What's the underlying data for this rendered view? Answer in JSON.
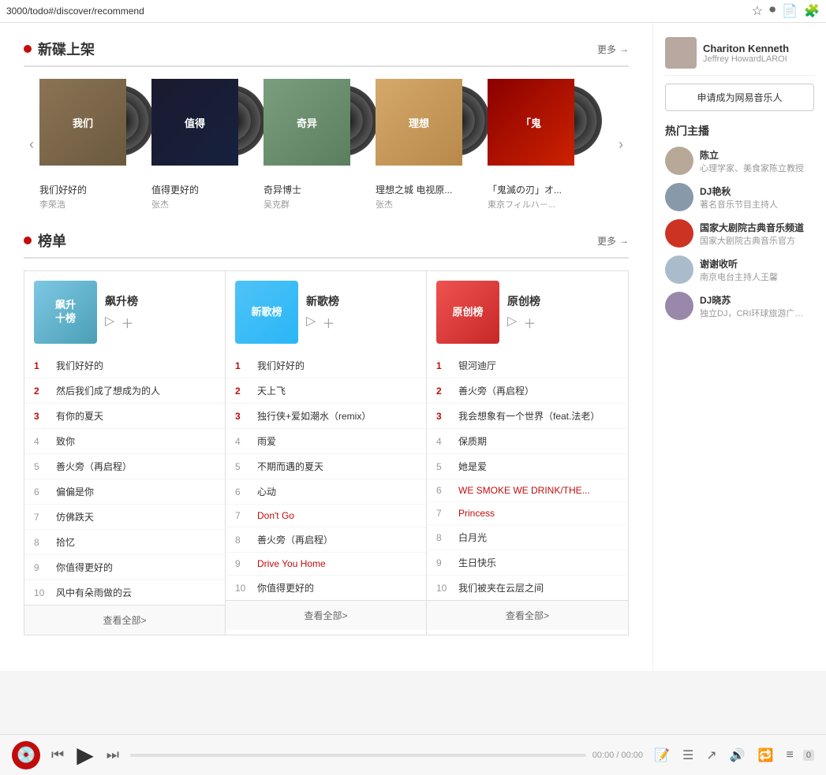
{
  "topbar": {
    "url": "3000/todo#/discover/recommend"
  },
  "newAlbums": {
    "title": "新碟上架",
    "moreLabel": "更多",
    "albums": [
      {
        "id": 1,
        "title": "我们好好的",
        "artist": "李荣浩",
        "coverClass": "cover-1"
      },
      {
        "id": 2,
        "title": "值得更好的",
        "artist": "张杰",
        "coverClass": "cover-2"
      },
      {
        "id": 3,
        "title": "奇异博士",
        "artist": "吴克群",
        "coverClass": "cover-3"
      },
      {
        "id": 4,
        "title": "理想之城 电视原...",
        "artist": "张杰",
        "coverClass": "cover-4"
      },
      {
        "id": 5,
        "title": "「鬼滅の刃」オ...",
        "artist": "東京フィルハ－...",
        "coverClass": "cover-5"
      }
    ]
  },
  "charts": {
    "title": "榜单",
    "moreLabel": "更多",
    "columns": [
      {
        "id": "feisheng",
        "name": "飙升榜",
        "coverClass": "chart-cover-feisheng",
        "coverText": "飙升\n十榜",
        "songs": [
          {
            "rank": 1,
            "title": "我们好好的",
            "isTop3": true
          },
          {
            "rank": 2,
            "title": "然后我们成了想成为的人",
            "isTop3": true
          },
          {
            "rank": 3,
            "title": "有你的夏天",
            "isTop3": true
          },
          {
            "rank": 4,
            "title": "致你",
            "isTop3": false
          },
          {
            "rank": 5,
            "title": "善火旁（再启程）",
            "isTop3": false
          },
          {
            "rank": 6,
            "title": "偏偏是你",
            "isTop3": false
          },
          {
            "rank": 7,
            "title": "仿佛跌天",
            "isTop3": false
          },
          {
            "rank": 8,
            "title": "拾忆",
            "isTop3": false
          },
          {
            "rank": 9,
            "title": "你值得更好的",
            "isTop3": false
          },
          {
            "rank": 10,
            "title": "风中有朵雨做的云",
            "isTop3": false
          }
        ],
        "footerLabel": "查看全部>"
      },
      {
        "id": "xinge",
        "name": "新歌榜",
        "coverClass": "chart-cover-xinge",
        "coverText": "新歌榜",
        "songs": [
          {
            "rank": 1,
            "title": "我们好好的",
            "isTop3": true
          },
          {
            "rank": 2,
            "title": "天上飞",
            "isTop3": true
          },
          {
            "rank": 3,
            "title": "独行侠+爱如潮水（remix）",
            "isTop3": true
          },
          {
            "rank": 4,
            "title": "雨爱",
            "isTop3": false
          },
          {
            "rank": 5,
            "title": "不期而遇的夏天",
            "isTop3": false
          },
          {
            "rank": 6,
            "title": "心动",
            "isTop3": false
          },
          {
            "rank": 7,
            "title": "Don't Go",
            "isTop3": false,
            "isEnglish": true
          },
          {
            "rank": 8,
            "title": "善火旁（再启程）",
            "isTop3": false
          },
          {
            "rank": 9,
            "title": "Drive You Home",
            "isTop3": false,
            "isEnglish": true
          },
          {
            "rank": 10,
            "title": "你值得更好的",
            "isTop3": false
          }
        ],
        "footerLabel": "查看全部>"
      },
      {
        "id": "yuanchuang",
        "name": "原创榜",
        "coverClass": "chart-cover-yuanchuang",
        "coverText": "原创榜",
        "songs": [
          {
            "rank": 1,
            "title": "银河迪厅",
            "isTop3": true
          },
          {
            "rank": 2,
            "title": "善火旁（再启程）",
            "isTop3": true
          },
          {
            "rank": 3,
            "title": "我会想象有一个世界（feat.法老）",
            "isTop3": true
          },
          {
            "rank": 4,
            "title": "保质期",
            "isTop3": false
          },
          {
            "rank": 5,
            "title": "她是爱",
            "isTop3": false
          },
          {
            "rank": 6,
            "title": "WE SMOKE WE DRINK/THE...",
            "isTop3": false,
            "isEnglish": true
          },
          {
            "rank": 7,
            "title": "Princess",
            "isTop3": false,
            "isEnglish": true
          },
          {
            "rank": 8,
            "title": "白月光",
            "isTop3": false
          },
          {
            "rank": 9,
            "title": "生日快乐",
            "isTop3": false
          },
          {
            "rank": 10,
            "title": "我们被夹在云层之间",
            "isTop3": false
          }
        ],
        "footerLabel": "查看全部>"
      }
    ]
  },
  "sidebar": {
    "applyBtnLabel": "申请成为网易音乐人",
    "hotBroadcastTitle": "热门主播",
    "broadcasters": [
      {
        "name": "陈立",
        "desc": "心理学家、美食家陈立教授",
        "avatarColor": "#b8a898"
      },
      {
        "name": "DJ艳秋",
        "desc": "著名音乐节目主持人",
        "avatarColor": "#8899aa"
      },
      {
        "name": "国家大剧院古典音乐频道",
        "desc": "国家大剧院古典音乐官方",
        "avatarColor": "#cc3322"
      },
      {
        "name": "谢谢收听",
        "desc": "南京电台主持人王馨",
        "avatarColor": "#aabbcc"
      },
      {
        "name": "DJ晓苏",
        "desc": "独立DJ，CRI环球旅游广播...",
        "avatarColor": "#9988aa"
      }
    ],
    "featuredUser": {
      "name": "Chariton Kenneth",
      "sub": "Jeffrey HowardLAROI"
    }
  },
  "player": {
    "prevLabel": "⏮",
    "playLabel": "▶",
    "nextLabel": "⏭",
    "time": "00:00 / 00:00",
    "volume": "0"
  }
}
